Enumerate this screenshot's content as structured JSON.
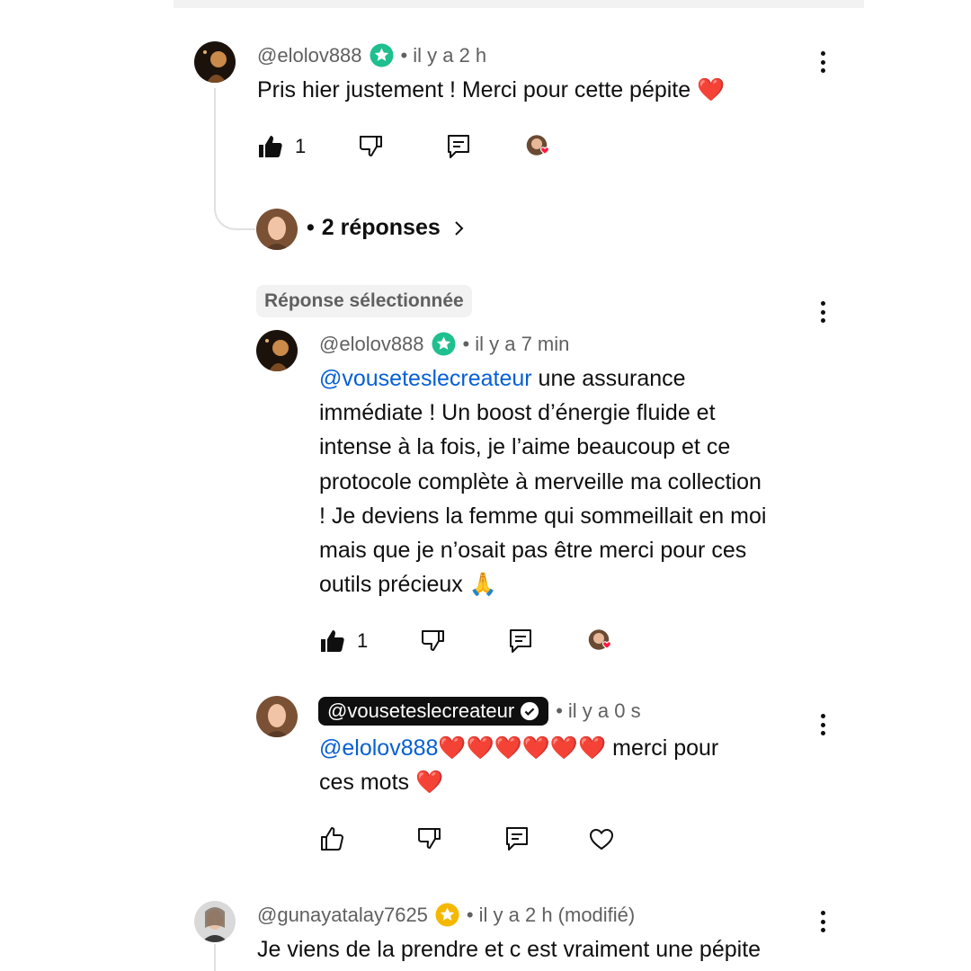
{
  "colors": {
    "mention": "#065fd4",
    "meta": "#606060",
    "heart": "#e0161e",
    "creator_chip_bg": "#0f0f0f",
    "verified_green": "#1fbf8f",
    "verified_gold": "#f5b800"
  },
  "comments": [
    {
      "author": "@elolov888",
      "badge_icon": "green-star-badge-icon",
      "time": "il y a 2 h",
      "text": "Pris hier justement ! Merci pour cette pépite",
      "emoji": "❤️",
      "likes": "1"
    },
    {
      "author": "@gunayatalay7625",
      "badge_icon": "gold-star-badge-icon",
      "time": "il y a 2 h (modifié)",
      "text": "Je viens de la prendre et c est vraiment une pépite"
    }
  ],
  "thread": {
    "replies_label": "2 réponses"
  },
  "selected_reply": {
    "chip": "Réponse sélectionnée",
    "author": "@elolov888",
    "time": "il y a 7 min",
    "mention": "@vouseteslecreateur",
    "lines": [
      " une assurance",
      "immédiate ! Un boost d’énergie fluide et",
      "intense à la fois, je l’aime beaucoup et ce",
      "protocole complète à merveille ma collection",
      "! Je deviens la femme qui sommeillait en moi",
      "mais que je n’osait pas être merci pour ces",
      "outils précieux"
    ],
    "emoji": "🙏",
    "likes": "1"
  },
  "creator_reply": {
    "author": "@vouseteslecreateur",
    "time": "il y a 0 s",
    "mention": "@elolov888",
    "hearts": "❤️❤️❤️❤️❤️❤️",
    "text1": " merci pour",
    "text2": "ces mots",
    "emoji": "❤️"
  }
}
